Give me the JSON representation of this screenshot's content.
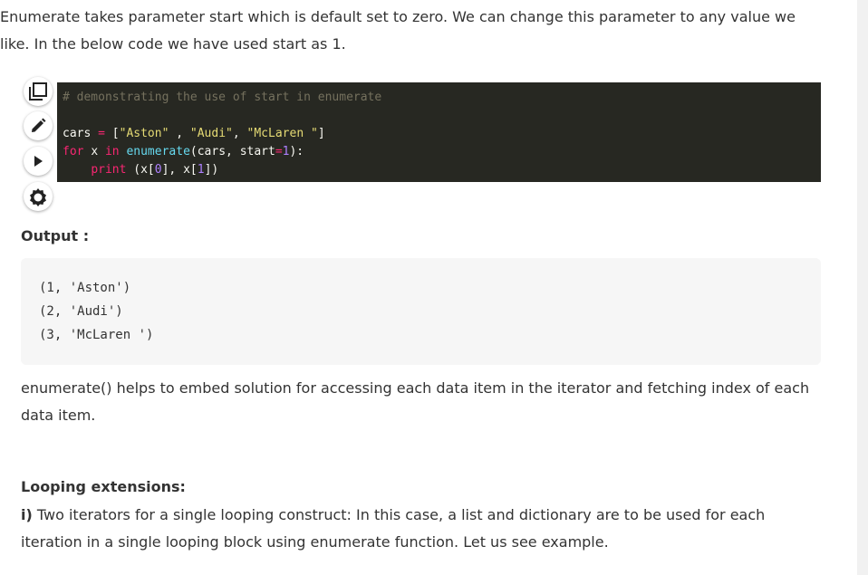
{
  "intro_text": "Enumerate takes parameter start which is default set to zero. We can change this parameter to any value we like. In the below code we have used start as 1.",
  "toolbar": {
    "copy_icon": "copy-icon",
    "edit_icon": "pencil-icon",
    "run_icon": "play-icon",
    "settings_icon": "gear-icon"
  },
  "code": {
    "comment": "# demonstrating the use of start in enumerate",
    "line1": {
      "var": "cars",
      "op": "=",
      "open": "[",
      "s1": "\"Aston\"",
      "sep1": " , ",
      "s2": "\"Audi\"",
      "sep2": ", ",
      "s3": "\"McLaren \"",
      "close": "]"
    },
    "line2": {
      "kw_for": "for",
      "var_x": "x",
      "kw_in": "in",
      "fn": "enumerate",
      "args_open": "(cars, start",
      "eq": "=",
      "num": "1",
      "args_close": "):"
    },
    "line3": {
      "kw_print": "print",
      "a1": " (x[",
      "n0": "0",
      "a2": "], x[",
      "n1": "1",
      "a3": "])"
    }
  },
  "output_label": "Output :",
  "output_lines": [
    "(1, 'Aston')",
    "(2, 'Audi')",
    "(3, 'McLaren ')"
  ],
  "description": "enumerate() helps to embed solution for accessing each data item in the iterator and fetching index of each data item.",
  "loop_title": "Looping extensions:",
  "loop_prefix": "i)",
  "loop_text": " Two iterators for a single looping construct: In this case, a list and dictionary are to be used for each iteration in a single looping block using enumerate function. Let us see example.",
  "colors": {
    "code_bg": "#272822",
    "comment": "#75715e",
    "string": "#e6db74",
    "keyword": "#f92672",
    "number": "#ae81ff",
    "function": "#66d9ef",
    "output_bg": "#f6f6f6"
  }
}
